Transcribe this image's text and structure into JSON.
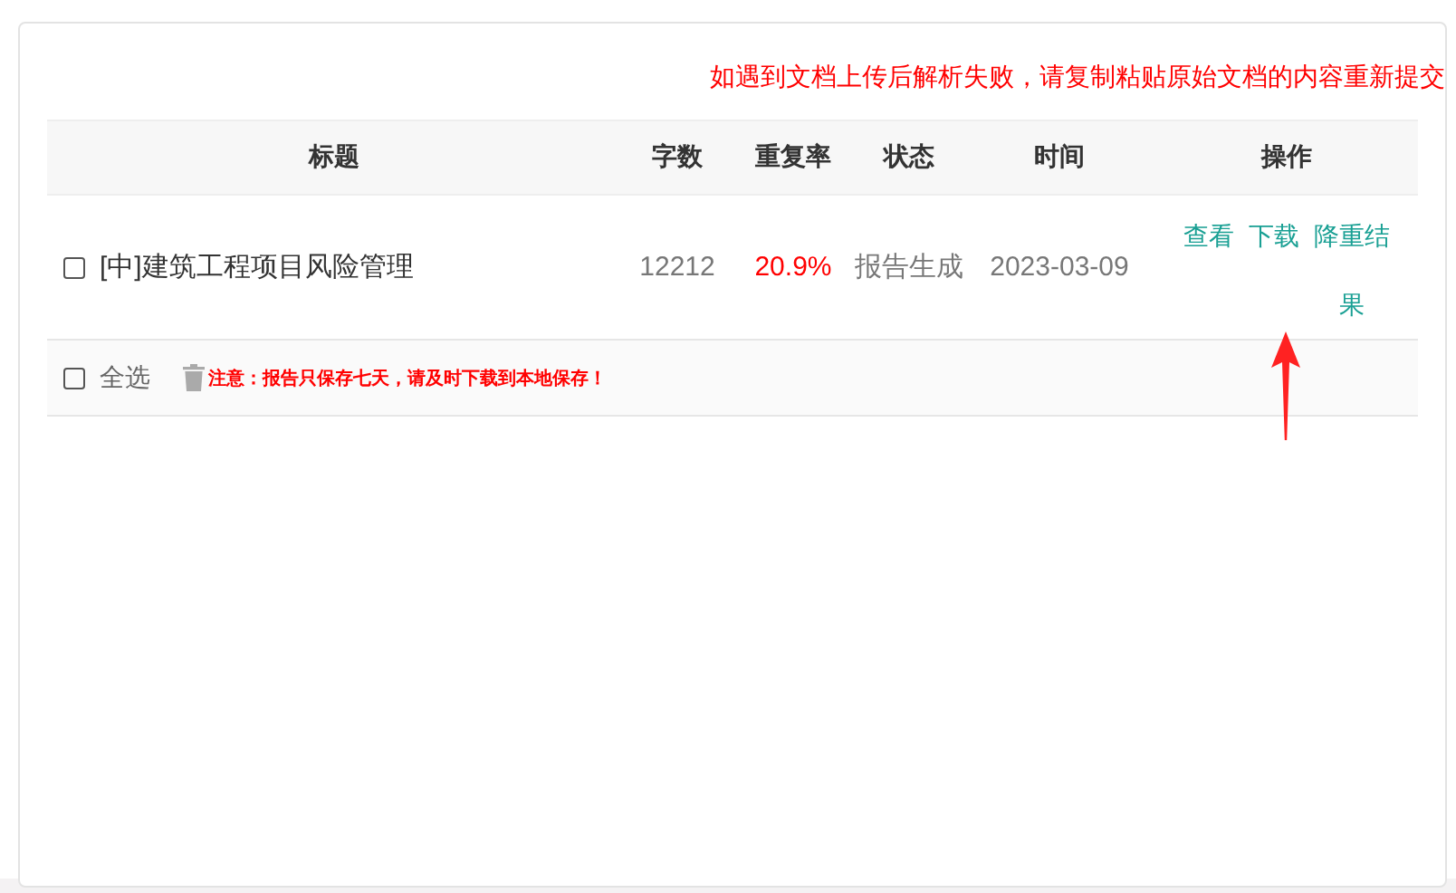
{
  "notice": "如遇到文档上传后解析失败，请复制粘贴原始文档的内容重新提交",
  "table": {
    "columns": [
      "标题",
      "字数",
      "重复率",
      "状态",
      "时间",
      "操作"
    ],
    "rows": [
      {
        "checked": false,
        "title": "[中]建筑工程项目风险管理",
        "word_count": "12212",
        "repeat_rate": "20.9%",
        "status": "报告生成",
        "time": "2023-03-09",
        "actions": [
          "查看",
          "下载",
          "降重结果"
        ]
      }
    ]
  },
  "footer": {
    "select_all": {
      "label": "全选",
      "checked": false
    },
    "note": "注意：报告只保存七天，请及时下载到本地保存！"
  }
}
